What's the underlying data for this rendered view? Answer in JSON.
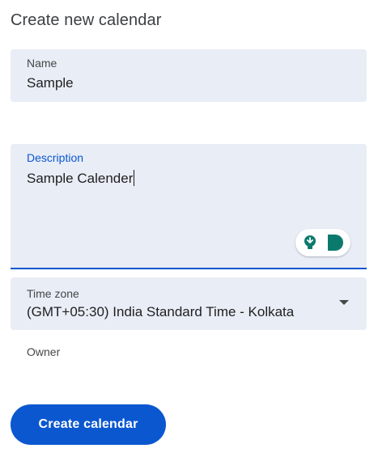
{
  "page": {
    "title": "Create new calendar"
  },
  "name_field": {
    "label": "Name",
    "value": "Sample"
  },
  "description_field": {
    "label": "Description",
    "value": "Sample Calender",
    "assist_icons": [
      "lightbulb-icon",
      "speech-bubble-icon"
    ],
    "icon_color": "#0b7a6d"
  },
  "timezone_field": {
    "label": "Time zone",
    "value": "(GMT+05:30) India Standard Time - Kolkata",
    "dropdown_icon": "chevron-down-icon"
  },
  "owner": {
    "label": "Owner"
  },
  "actions": {
    "create_label": "Create calendar",
    "primary_color": "#0b57d0"
  }
}
